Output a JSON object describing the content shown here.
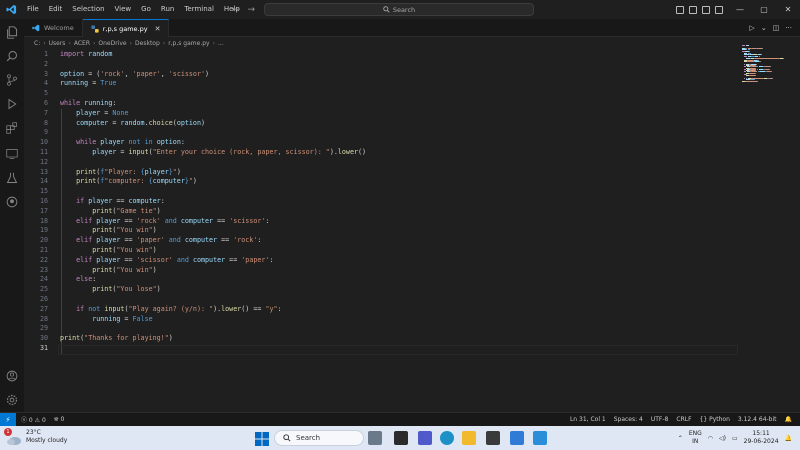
{
  "menu": [
    "File",
    "Edit",
    "Selection",
    "View",
    "Go",
    "Run",
    "Terminal",
    "Help"
  ],
  "search": {
    "label": "Search"
  },
  "tabs": [
    {
      "label": "Welcome",
      "active": false
    },
    {
      "label": "r,p,s game.py",
      "active": true
    }
  ],
  "breadcrumb": [
    "C:",
    "Users",
    "ACER",
    "OneDrive",
    "Desktop",
    "r,p,s game.py",
    "..."
  ],
  "code": [
    [
      [
        "kw",
        "import"
      ],
      [
        "op",
        " "
      ],
      [
        "var",
        "random"
      ]
    ],
    [],
    [
      [
        "var",
        "option"
      ],
      [
        "op",
        " = ("
      ],
      [
        "str",
        "'rock'"
      ],
      [
        "op",
        ", "
      ],
      [
        "str",
        "'paper'"
      ],
      [
        "op",
        ", "
      ],
      [
        "str",
        "'scissor'"
      ],
      [
        "op",
        ")"
      ]
    ],
    [
      [
        "var",
        "running"
      ],
      [
        "op",
        " = "
      ],
      [
        "bool",
        "True"
      ]
    ],
    [],
    [
      [
        "kw",
        "while"
      ],
      [
        "op",
        " "
      ],
      [
        "var",
        "running"
      ],
      [
        "op",
        ":"
      ]
    ],
    [
      [
        "op",
        "    "
      ],
      [
        "var",
        "player"
      ],
      [
        "op",
        " = "
      ],
      [
        "bool",
        "None"
      ]
    ],
    [
      [
        "op",
        "    "
      ],
      [
        "var",
        "computer"
      ],
      [
        "op",
        " = "
      ],
      [
        "var",
        "random"
      ],
      [
        "op",
        "."
      ],
      [
        "fn",
        "choice"
      ],
      [
        "op",
        "("
      ],
      [
        "var",
        "option"
      ],
      [
        "op",
        ")"
      ]
    ],
    [],
    [
      [
        "op",
        "    "
      ],
      [
        "kw",
        "while"
      ],
      [
        "op",
        " "
      ],
      [
        "var",
        "player"
      ],
      [
        "op",
        " "
      ],
      [
        "kwb",
        "not in"
      ],
      [
        "op",
        " "
      ],
      [
        "var",
        "option"
      ],
      [
        "op",
        ":"
      ]
    ],
    [
      [
        "op",
        "        "
      ],
      [
        "var",
        "player"
      ],
      [
        "op",
        " = "
      ],
      [
        "fn",
        "input"
      ],
      [
        "op",
        "("
      ],
      [
        "str",
        "\"Enter your choice (rock, paper, scissor): \""
      ],
      [
        "op",
        ")."
      ],
      [
        "fn",
        "lower"
      ],
      [
        "op",
        "()"
      ]
    ],
    [],
    [
      [
        "op",
        "    "
      ],
      [
        "fn",
        "print"
      ],
      [
        "op",
        "("
      ],
      [
        "kwb",
        "f"
      ],
      [
        "str",
        "\"Player: "
      ],
      [
        "kwb",
        "{"
      ],
      [
        "var",
        "player"
      ],
      [
        "kwb",
        "}"
      ],
      [
        "str",
        "\""
      ],
      [
        "op",
        ")"
      ]
    ],
    [
      [
        "op",
        "    "
      ],
      [
        "fn",
        "print"
      ],
      [
        "op",
        "("
      ],
      [
        "kwb",
        "f"
      ],
      [
        "str",
        "\"computer: "
      ],
      [
        "kwb",
        "{"
      ],
      [
        "var",
        "computer"
      ],
      [
        "kwb",
        "}"
      ],
      [
        "str",
        "\""
      ],
      [
        "op",
        ")"
      ]
    ],
    [],
    [
      [
        "op",
        "    "
      ],
      [
        "kw",
        "if"
      ],
      [
        "op",
        " "
      ],
      [
        "var",
        "player"
      ],
      [
        "op",
        " == "
      ],
      [
        "var",
        "computer"
      ],
      [
        "op",
        ":"
      ]
    ],
    [
      [
        "op",
        "        "
      ],
      [
        "fn",
        "print"
      ],
      [
        "op",
        "("
      ],
      [
        "str",
        "\"Game tie\""
      ],
      [
        "op",
        ")"
      ]
    ],
    [
      [
        "op",
        "    "
      ],
      [
        "kw",
        "elif"
      ],
      [
        "op",
        " "
      ],
      [
        "var",
        "player"
      ],
      [
        "op",
        " == "
      ],
      [
        "str",
        "'rock'"
      ],
      [
        "op",
        " "
      ],
      [
        "kwb",
        "and"
      ],
      [
        "op",
        " "
      ],
      [
        "var",
        "computer"
      ],
      [
        "op",
        " == "
      ],
      [
        "str",
        "'scissor'"
      ],
      [
        "op",
        ":"
      ]
    ],
    [
      [
        "op",
        "        "
      ],
      [
        "fn",
        "print"
      ],
      [
        "op",
        "("
      ],
      [
        "str",
        "\"You win\""
      ],
      [
        "op",
        ")"
      ]
    ],
    [
      [
        "op",
        "    "
      ],
      [
        "kw",
        "elif"
      ],
      [
        "op",
        " "
      ],
      [
        "var",
        "player"
      ],
      [
        "op",
        " == "
      ],
      [
        "str",
        "'paper'"
      ],
      [
        "op",
        " "
      ],
      [
        "kwb",
        "and"
      ],
      [
        "op",
        " "
      ],
      [
        "var",
        "computer"
      ],
      [
        "op",
        " == "
      ],
      [
        "str",
        "'rock'"
      ],
      [
        "op",
        ":"
      ]
    ],
    [
      [
        "op",
        "        "
      ],
      [
        "fn",
        "print"
      ],
      [
        "op",
        "("
      ],
      [
        "str",
        "\"You win\""
      ],
      [
        "op",
        ")"
      ]
    ],
    [
      [
        "op",
        "    "
      ],
      [
        "kw",
        "elif"
      ],
      [
        "op",
        " "
      ],
      [
        "var",
        "player"
      ],
      [
        "op",
        " == "
      ],
      [
        "str",
        "'scissor'"
      ],
      [
        "op",
        " "
      ],
      [
        "kwb",
        "and"
      ],
      [
        "op",
        " "
      ],
      [
        "var",
        "computer"
      ],
      [
        "op",
        " == "
      ],
      [
        "str",
        "'paper'"
      ],
      [
        "op",
        ":"
      ]
    ],
    [
      [
        "op",
        "        "
      ],
      [
        "fn",
        "print"
      ],
      [
        "op",
        "("
      ],
      [
        "str",
        "\"You win\""
      ],
      [
        "op",
        ")"
      ]
    ],
    [
      [
        "op",
        "    "
      ],
      [
        "kw",
        "else"
      ],
      [
        "op",
        ":"
      ]
    ],
    [
      [
        "op",
        "        "
      ],
      [
        "fn",
        "print"
      ],
      [
        "op",
        "("
      ],
      [
        "str",
        "\"You lose\""
      ],
      [
        "op",
        ")"
      ]
    ],
    [],
    [
      [
        "op",
        "    "
      ],
      [
        "kw",
        "if"
      ],
      [
        "op",
        " "
      ],
      [
        "kwb",
        "not"
      ],
      [
        "op",
        " "
      ],
      [
        "fn",
        "input"
      ],
      [
        "op",
        "("
      ],
      [
        "str",
        "\"Play again? (y/n): \""
      ],
      [
        "op",
        ")."
      ],
      [
        "fn",
        "lower"
      ],
      [
        "op",
        "() == "
      ],
      [
        "str",
        "\"y\""
      ],
      [
        "op",
        ":"
      ]
    ],
    [
      [
        "op",
        "        "
      ],
      [
        "var",
        "running"
      ],
      [
        "op",
        " = "
      ],
      [
        "bool",
        "False"
      ]
    ],
    [],
    [
      [
        "fn",
        "print"
      ],
      [
        "op",
        "("
      ],
      [
        "str",
        "\"Thanks for playing!\""
      ],
      [
        "op",
        ")"
      ]
    ],
    []
  ],
  "status": {
    "errors": "0",
    "warnings": "0",
    "ports": "0",
    "position": "Ln 31, Col 1",
    "spaces": "Spaces: 4",
    "encoding": "UTF-8",
    "eol": "CRLF",
    "language": "Python",
    "interpreter": "3.12.4 64-bit"
  },
  "taskbar": {
    "weather_temp": "23°C",
    "weather_desc": "Mostly cloudy",
    "weather_badge": "1",
    "search_label": "Search",
    "lang_top": "ENG",
    "lang_bottom": "IN",
    "time": "15:11",
    "date": "29-06-2024"
  },
  "colors": {
    "accent": "#0078d4",
    "keyword": "#c586c0",
    "string": "#ce9178",
    "function": "#dcdcaa",
    "variable": "#9cdcfe"
  }
}
